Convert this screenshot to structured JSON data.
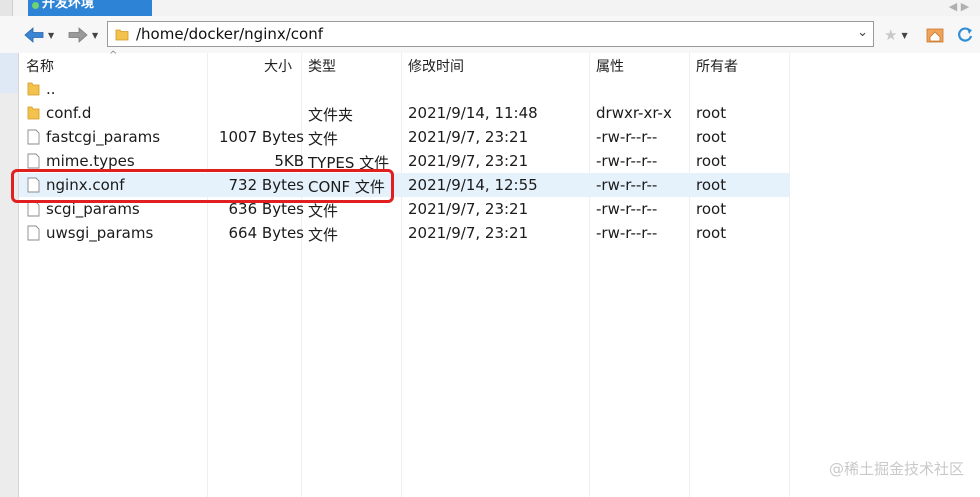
{
  "tabs": {
    "active_label": "开发环境"
  },
  "address": {
    "path": "/home/docker/nginx/conf"
  },
  "columns": {
    "name": "名称",
    "size": "大小",
    "type": "类型",
    "modified": "修改时间",
    "attributes": "属性",
    "owner": "所有者"
  },
  "files": [
    {
      "name": "..",
      "size": "",
      "type": "",
      "modified": "",
      "attributes": "",
      "owner": "",
      "icon": "folder-icon"
    },
    {
      "name": "conf.d",
      "size": "",
      "type": "文件夹",
      "modified": "2021/9/14, 11:48",
      "attributes": "drwxr-xr-x",
      "owner": "root",
      "icon": "folder-icon"
    },
    {
      "name": "fastcgi_params",
      "size": "1007 Bytes",
      "type": "文件",
      "modified": "2021/9/7, 23:21",
      "attributes": "-rw-r--r--",
      "owner": "root",
      "icon": "file-icon"
    },
    {
      "name": "mime.types",
      "size": "5KB",
      "type": "TYPES 文件",
      "modified": "2021/9/7, 23:21",
      "attributes": "-rw-r--r--",
      "owner": "root",
      "icon": "file-icon"
    },
    {
      "name": "nginx.conf",
      "size": "732 Bytes",
      "type": "CONF 文件",
      "modified": "2021/9/14, 12:55",
      "attributes": "-rw-r--r--",
      "owner": "root",
      "icon": "file-icon"
    },
    {
      "name": "scgi_params",
      "size": "636 Bytes",
      "type": "文件",
      "modified": "2021/9/7, 23:21",
      "attributes": "-rw-r--r--",
      "owner": "root",
      "icon": "file-icon"
    },
    {
      "name": "uwsgi_params",
      "size": "664 Bytes",
      "type": "文件",
      "modified": "2021/9/7, 23:21",
      "attributes": "-rw-r--r--",
      "owner": "root",
      "icon": "file-icon"
    }
  ],
  "selected_file": "nginx.conf",
  "watermark": "@稀土掘金技术社区",
  "colors": {
    "accent": "#2d83d6",
    "highlight": "#e02020",
    "selection": "#e5f1fb"
  }
}
